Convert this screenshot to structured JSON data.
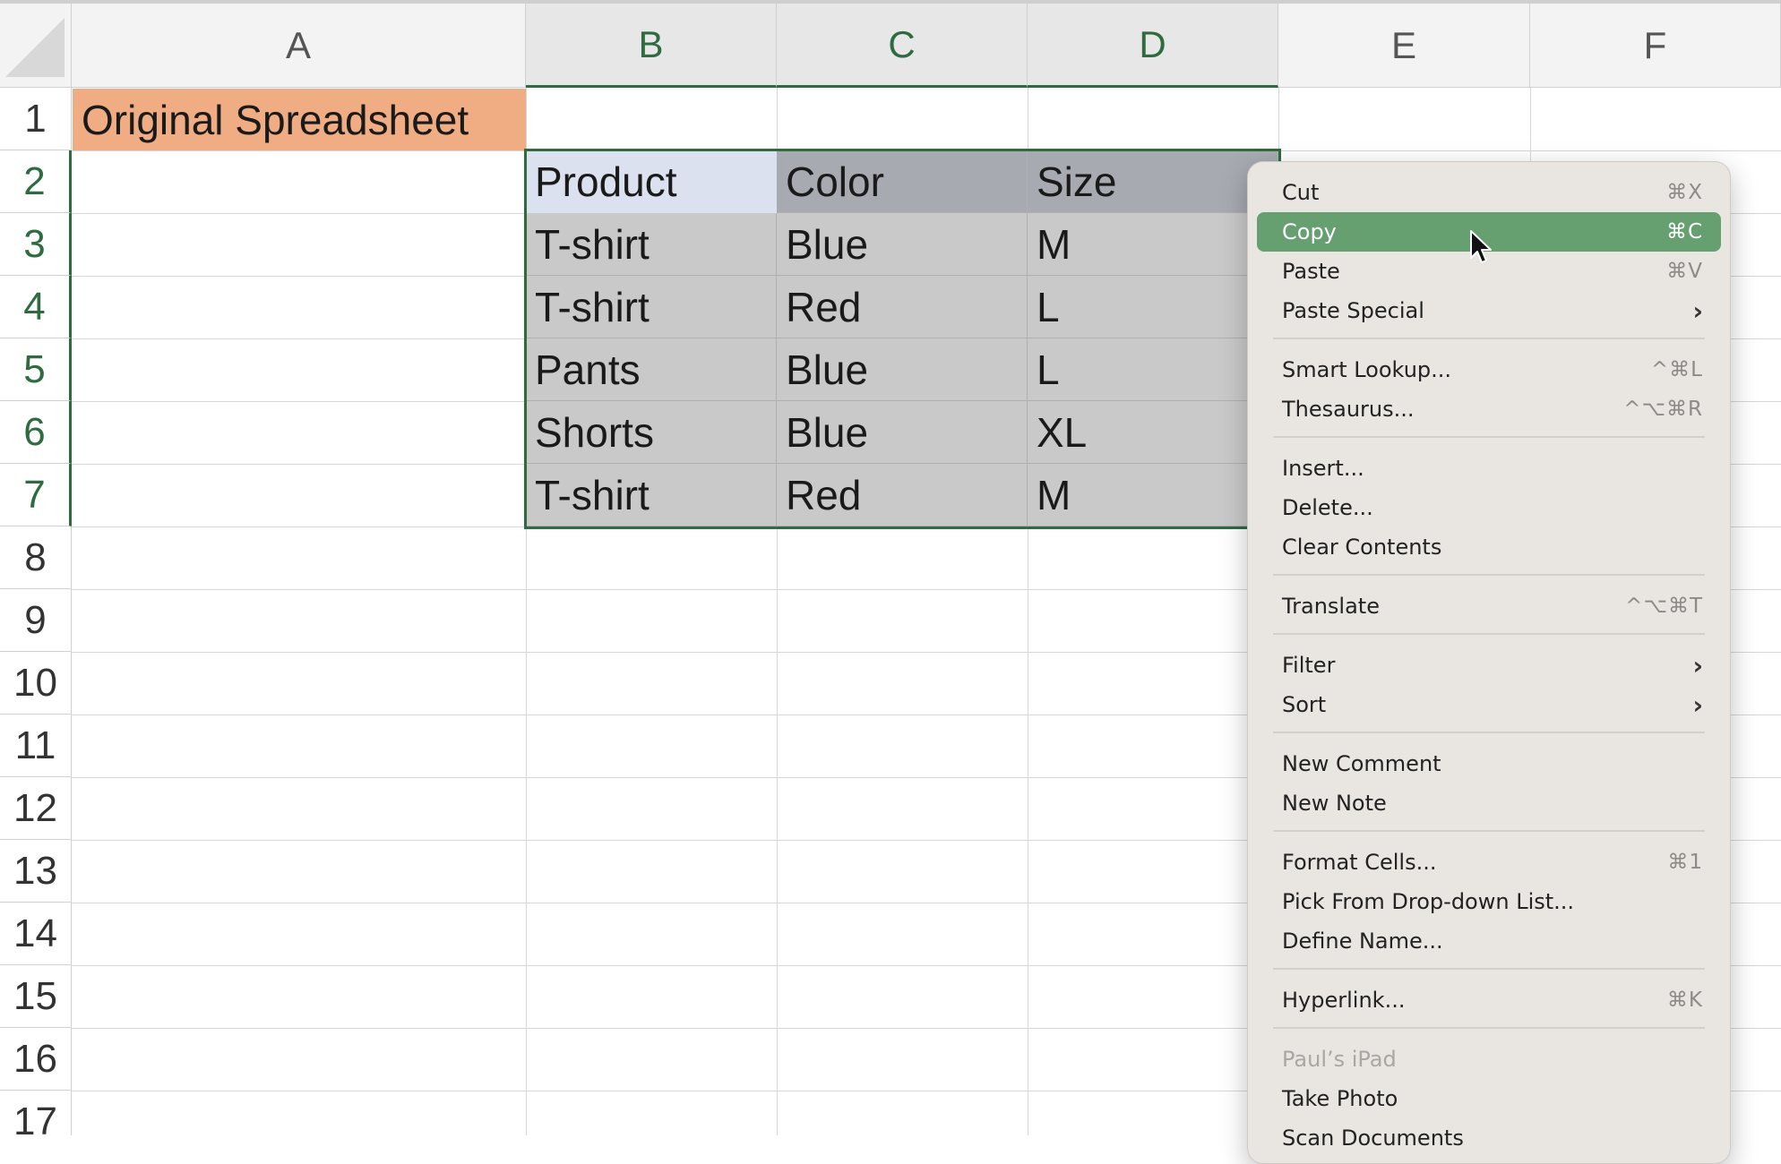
{
  "columns": [
    "A",
    "B",
    "C",
    "D",
    "E",
    "F"
  ],
  "rows": [
    "1",
    "2",
    "3",
    "4",
    "5",
    "6",
    "7",
    "8",
    "9",
    "10",
    "11",
    "12",
    "13",
    "14",
    "15",
    "16",
    "17"
  ],
  "cells": {
    "A1": "Original Spreadsheet",
    "table": [
      [
        "Product",
        "Color",
        "Size"
      ],
      [
        "T-shirt",
        "Blue",
        "M"
      ],
      [
        "T-shirt",
        "Red",
        "L"
      ],
      [
        "Pants",
        "Blue",
        "L"
      ],
      [
        "Shorts",
        "Blue",
        "XL"
      ],
      [
        "T-shirt",
        "Red",
        "M"
      ]
    ]
  },
  "colors": {
    "title_fill": "#f0ad84",
    "selection_border": "#2e6b3f",
    "menu_highlight": "#66a070"
  },
  "context_menu": {
    "items": [
      {
        "label": "Cut",
        "shortcut": "⌘X"
      },
      {
        "label": "Copy",
        "shortcut": "⌘C",
        "highlighted": true
      },
      {
        "label": "Paste",
        "shortcut": "⌘V"
      },
      {
        "label": "Paste Special",
        "submenu": "›"
      },
      {
        "label": "Smart Lookup...",
        "shortcut": "^⌘L"
      },
      {
        "label": "Thesaurus...",
        "shortcut": "^⌥⌘R"
      },
      {
        "label": "Insert..."
      },
      {
        "label": "Delete..."
      },
      {
        "label": "Clear Contents"
      },
      {
        "label": "Translate",
        "shortcut": "^⌥⌘T"
      },
      {
        "label": "Filter",
        "submenu": "›"
      },
      {
        "label": "Sort",
        "submenu": "›"
      },
      {
        "label": "New Comment"
      },
      {
        "label": "New Note"
      },
      {
        "label": "Format Cells...",
        "shortcut": "⌘1"
      },
      {
        "label": "Pick From Drop-down List..."
      },
      {
        "label": "Define Name..."
      },
      {
        "label": "Hyperlink...",
        "shortcut": "⌘K"
      },
      {
        "label": "Paul’s iPad",
        "disabled": true
      },
      {
        "label": "Take Photo"
      },
      {
        "label": "Scan Documents"
      }
    ]
  }
}
